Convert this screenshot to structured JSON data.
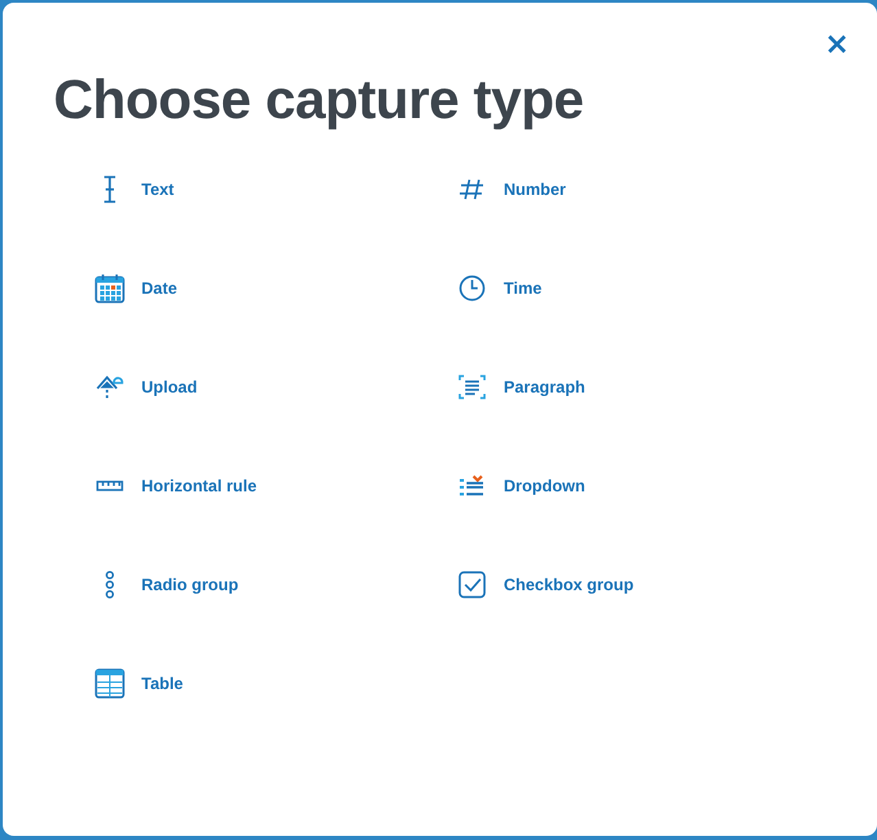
{
  "dialog": {
    "title": "Choose capture type",
    "close": "×"
  },
  "types": [
    {
      "kind": "text",
      "label": "Text"
    },
    {
      "kind": "number",
      "label": "Number"
    },
    {
      "kind": "date",
      "label": "Date"
    },
    {
      "kind": "time",
      "label": "Time"
    },
    {
      "kind": "upload",
      "label": "Upload"
    },
    {
      "kind": "paragraph",
      "label": "Paragraph"
    },
    {
      "kind": "rule",
      "label": "Horizontal rule"
    },
    {
      "kind": "dropdown",
      "label": "Dropdown"
    },
    {
      "kind": "radio",
      "label": "Radio group"
    },
    {
      "kind": "checkbox",
      "label": "Checkbox group"
    },
    {
      "kind": "table",
      "label": "Table"
    }
  ]
}
